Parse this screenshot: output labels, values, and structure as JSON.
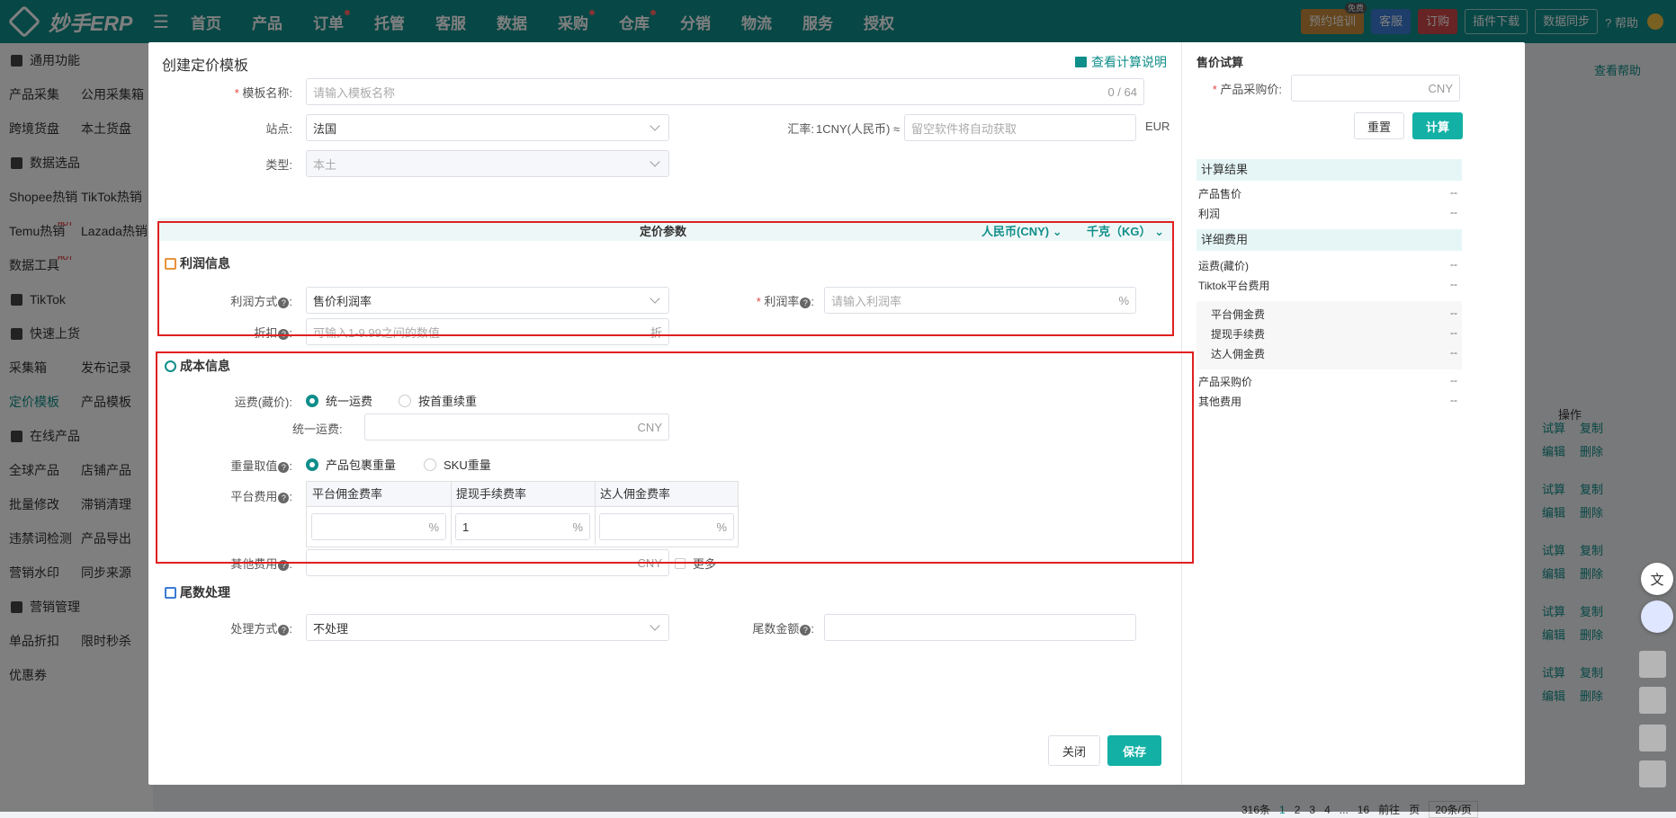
{
  "app": {
    "logo": "妙手ERP",
    "nav": [
      {
        "label": "首页",
        "dot": false
      },
      {
        "label": "产品",
        "dot": false
      },
      {
        "label": "订单",
        "dot": true
      },
      {
        "label": "托管",
        "dot": false
      },
      {
        "label": "客服",
        "dot": false
      },
      {
        "label": "数据",
        "dot": false
      },
      {
        "label": "采购",
        "dot": true
      },
      {
        "label": "仓库",
        "dot": true
      },
      {
        "label": "分销",
        "dot": false
      },
      {
        "label": "物流",
        "dot": false
      },
      {
        "label": "服务",
        "dot": false
      },
      {
        "label": "授权",
        "dot": false
      }
    ],
    "top_right": {
      "training": "预约培训",
      "training_badge": "免费",
      "service": "客服",
      "order": "订购",
      "plugin": "插件下载",
      "sync": "数据同步",
      "help": "帮助"
    }
  },
  "sidebar": {
    "rows": [
      {
        "type": "sec",
        "label": "通用功能"
      },
      {
        "type": "pair",
        "a": "产品采集",
        "b": "公用采集箱"
      },
      {
        "type": "pair",
        "a": "跨境货盘",
        "b": "本土货盘"
      },
      {
        "type": "sec",
        "label": "数据选品"
      },
      {
        "type": "pair",
        "a": "Shopee热销",
        "b": "TikTok热销"
      },
      {
        "type": "pair",
        "a": "Temu热销",
        "b": "Lazada热销",
        "hot_a": "HOT"
      },
      {
        "type": "pair",
        "a": "数据工具",
        "b": "",
        "hot_a": "HOT"
      },
      {
        "type": "sec",
        "label": "TikTok"
      },
      {
        "type": "sec",
        "label": "快速上货"
      },
      {
        "type": "pair",
        "a": "采集箱",
        "b": "发布记录"
      },
      {
        "type": "pair",
        "a": "定价模板",
        "b": "产品模板",
        "active_a": true
      },
      {
        "type": "sec",
        "label": "在线产品"
      },
      {
        "type": "pair",
        "a": "全球产品",
        "b": "店铺产品"
      },
      {
        "type": "pair",
        "a": "批量修改",
        "b": "滞销清理"
      },
      {
        "type": "pair",
        "a": "违禁词检测",
        "b": "产品导出"
      },
      {
        "type": "pair",
        "a": "营销水印",
        "b": "同步来源"
      },
      {
        "type": "sec",
        "label": "营销管理"
      },
      {
        "type": "pair",
        "a": "单品折扣",
        "b": "限时秒杀"
      },
      {
        "type": "pair",
        "a": "优惠券",
        "b": ""
      }
    ]
  },
  "background": {
    "help": "查看帮助",
    "ops": "操作",
    "row_actions": [
      "试算",
      "复制",
      "编辑",
      "删除"
    ],
    "pager": {
      "total": "316条",
      "pages": [
        "1",
        "2",
        "3",
        "4",
        "...",
        "16"
      ],
      "goto": "前往",
      "page": "页",
      "size": "20条/页"
    }
  },
  "dialog": {
    "title": "创建定价模板",
    "help_link": "查看计算说明",
    "name": {
      "label": "模板名称:",
      "placeholder": "请输入模板名称",
      "count": "0 / 64"
    },
    "site": {
      "label": "站点:",
      "value": "法国"
    },
    "rate": {
      "label": "汇率:",
      "prefix": "1CNY(人民币) ≈",
      "placeholder": "留空软件将自动获取",
      "suffix": "EUR"
    },
    "type": {
      "label": "类型:",
      "value": "本土"
    },
    "band": {
      "title": "定价参数",
      "currency": "人民币(CNY)",
      "weight": "千克（KG）"
    },
    "profit": {
      "title": "利润信息",
      "method_label": "利润方式",
      "method": "售价利润率",
      "rate_label": "利润率",
      "rate_placeholder": "请输入利润率",
      "rate_suffix": "%",
      "discount_label": "折扣",
      "discount_placeholder": "可输入1-9.99之间的数值",
      "discount_suffix": "折"
    },
    "cost": {
      "title": "成本信息",
      "freight_label": "运费(藏价):",
      "freight_opt1": "统一运费",
      "freight_opt2": "按首重续重",
      "unified_label": "统一运费:",
      "unified_suffix": "CNY",
      "weight_label": "重量取值",
      "weight_opt1": "产品包裹重量",
      "weight_opt2": "SKU重量",
      "platform_label": "平台费用",
      "cols": [
        "平台佣金费率",
        "提现手续费率",
        "达人佣金费率"
      ],
      "values": [
        "",
        "1",
        ""
      ],
      "pct": "%",
      "other_label": "其他费用",
      "other_suffix": "CNY",
      "more": "更多"
    },
    "tail": {
      "title": "尾数处理",
      "method_label": "处理方式",
      "method": "不处理",
      "amount_label": "尾数金额"
    },
    "buttons": {
      "close": "关闭",
      "save": "保存"
    },
    "calc": {
      "title": "售价试算",
      "purchase_label": "产品采购价:",
      "purchase_suffix": "CNY",
      "reset": "重置",
      "compute": "计算",
      "result_title": "计算结果",
      "results": [
        {
          "k": "产品售价",
          "v": "--"
        },
        {
          "k": "利润",
          "v": "--"
        }
      ],
      "detail_title": "详细费用",
      "details": [
        {
          "k": "运费(藏价)",
          "v": "--"
        },
        {
          "k": "Tiktok平台费用",
          "v": "--"
        }
      ],
      "sub": [
        {
          "k": "平台佣金费",
          "v": "--"
        },
        {
          "k": "提现手续费",
          "v": "--"
        },
        {
          "k": "达人佣金费",
          "v": "--"
        }
      ],
      "more": [
        {
          "k": "产品采购价",
          "v": "--"
        },
        {
          "k": "其他费用",
          "v": "--"
        }
      ]
    }
  }
}
